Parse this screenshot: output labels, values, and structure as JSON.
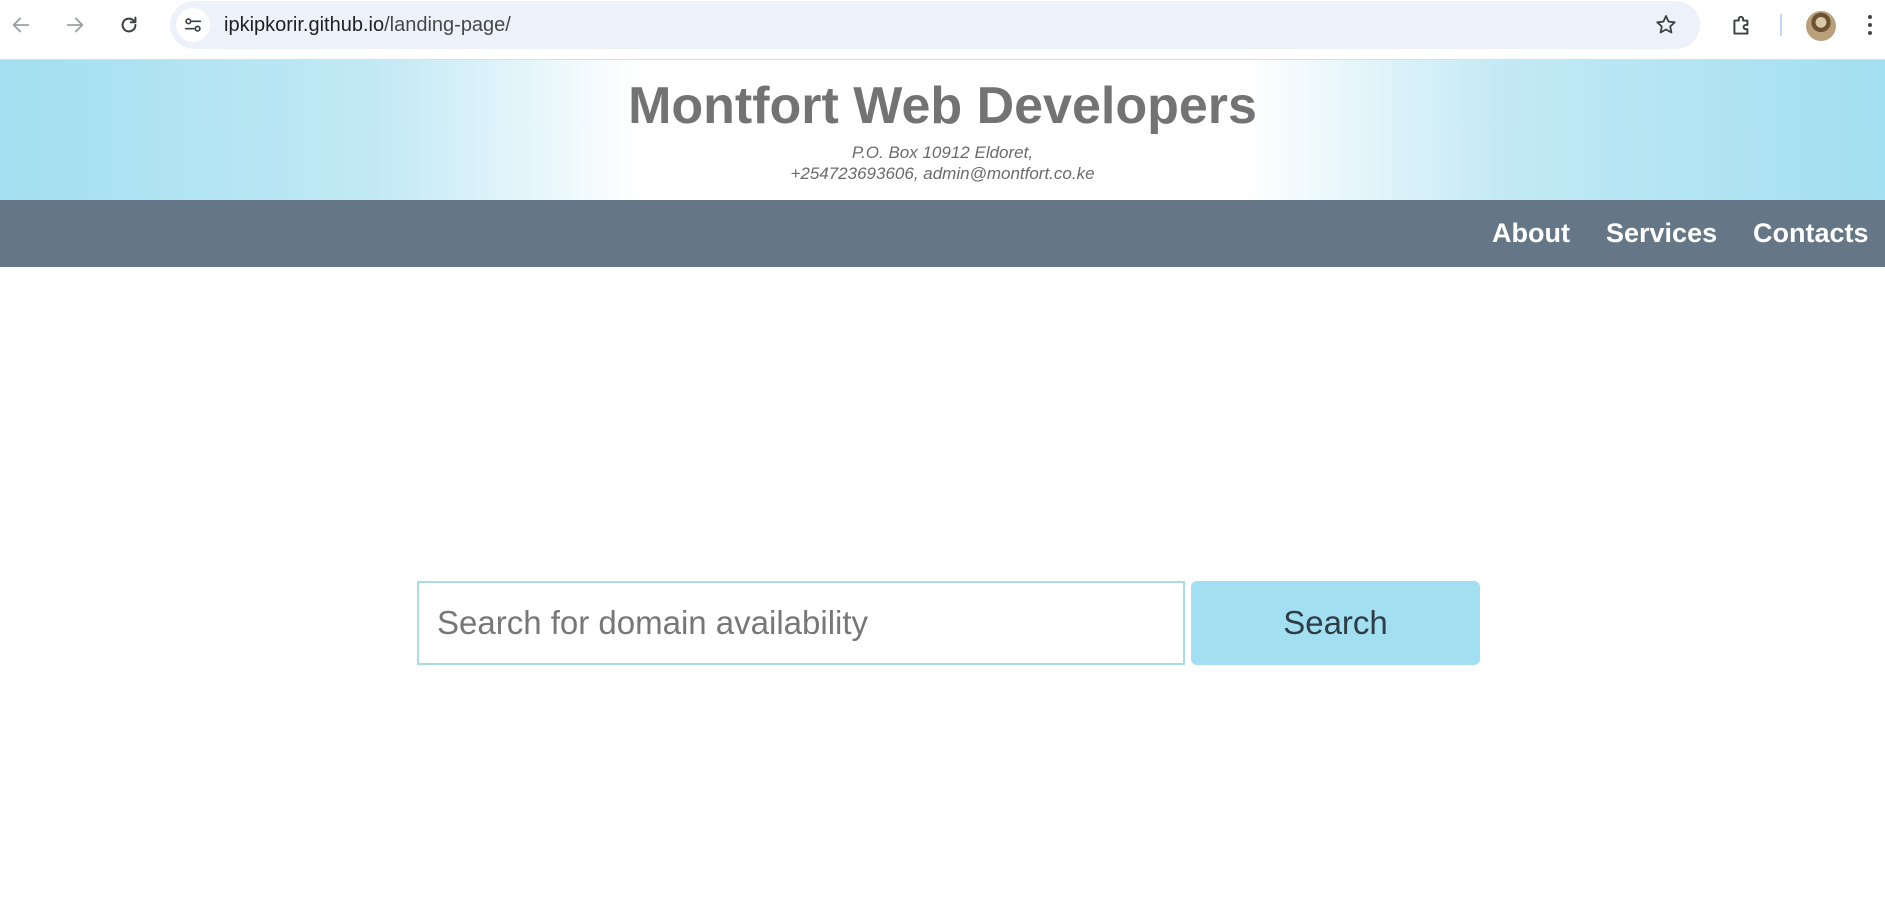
{
  "browser": {
    "url_host": "ipkipkorir.github.io",
    "url_path": "/landing-page/",
    "icons": [
      "back-arrow-icon",
      "forward-arrow-icon",
      "reload-icon",
      "site-settings-icon",
      "bookmark-star-icon",
      "extensions-puzzle-icon",
      "profile-avatar",
      "more-vertical-icon"
    ]
  },
  "header": {
    "title": "Montfort Web Developers",
    "address_line_1": "P.O. Box 10912 Eldoret,",
    "address_line_2": "+254723693606, admin@montfort.co.ke"
  },
  "nav": {
    "items": [
      {
        "label": "About"
      },
      {
        "label": "Services"
      },
      {
        "label": "Contacts"
      }
    ]
  },
  "search": {
    "placeholder": "Search for domain availability",
    "value": "",
    "button_label": "Search"
  },
  "colors": {
    "header_gradient_edge": "#a2dff0",
    "nav_background": "#657686",
    "nav_text": "#ffffff",
    "title_text": "#737373",
    "search_button_bg": "#a2dff0",
    "search_input_border": "#a8dce6"
  }
}
